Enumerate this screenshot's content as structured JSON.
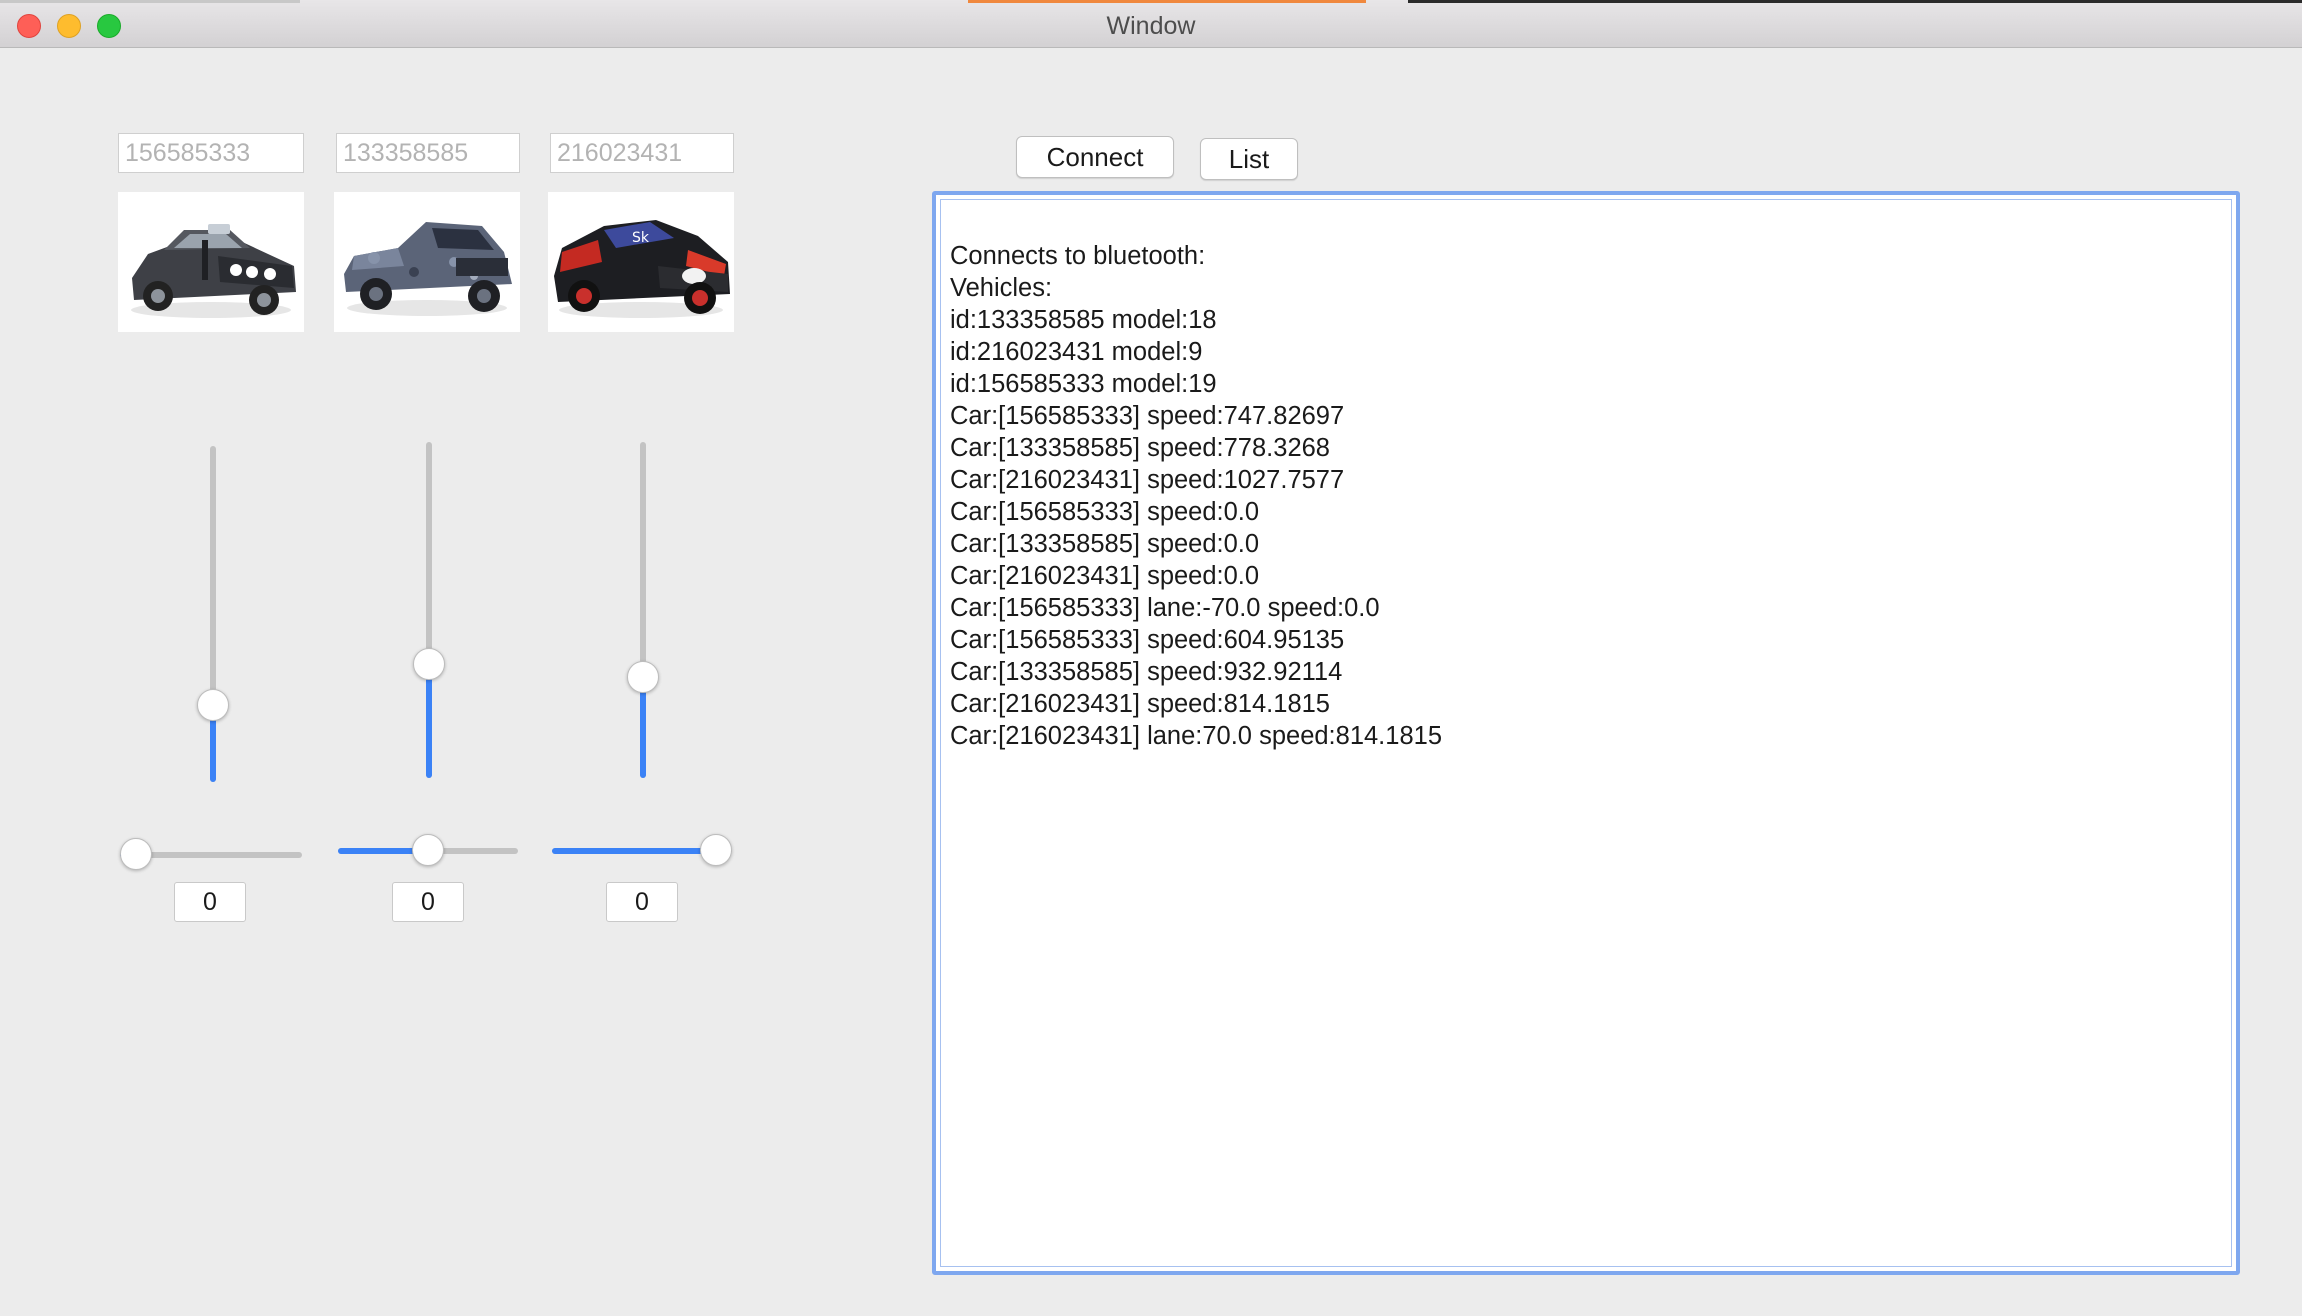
{
  "window": {
    "title": "Window"
  },
  "colors": {
    "accent": "#3b82f6",
    "focus_ring": "#7ea7ef",
    "close": "#fe5f57",
    "minimize": "#febc2e",
    "maximize": "#28c840",
    "tab_active": "#f0883e"
  },
  "vehicles": [
    {
      "id_field": "156585333",
      "image": "dark muscle car",
      "speed_slider_fraction": 0.23,
      "lane_slider_fraction": 0.0,
      "value": "0"
    },
    {
      "id_field": "133358585",
      "image": "camouflage pickup truck",
      "speed_slider_fraction": 0.34,
      "lane_slider_fraction": 0.5,
      "value": "0"
    },
    {
      "id_field": "216023431",
      "image": "black and red sports car",
      "speed_slider_fraction": 0.3,
      "lane_slider_fraction": 1.0,
      "value": "0"
    }
  ],
  "toolbar": {
    "connect_label": "Connect",
    "list_label": "List"
  },
  "log": {
    "lines": [
      "Connects to bluetooth:",
      "Vehicles:",
      "id:133358585 model:18",
      "id:216023431 model:9",
      "id:156585333 model:19",
      "Car:[156585333] speed:747.82697",
      "Car:[133358585] speed:778.3268",
      "Car:[216023431] speed:1027.7577",
      "Car:[156585333] speed:0.0",
      "Car:[133358585] speed:0.0",
      "Car:[216023431] speed:0.0",
      "Car:[156585333] lane:-70.0 speed:0.0",
      "Car:[156585333] speed:604.95135",
      "Car:[133358585] speed:932.92114",
      "Car:[216023431] speed:814.1815",
      "Car:[216023431] lane:70.0 speed:814.1815"
    ]
  }
}
